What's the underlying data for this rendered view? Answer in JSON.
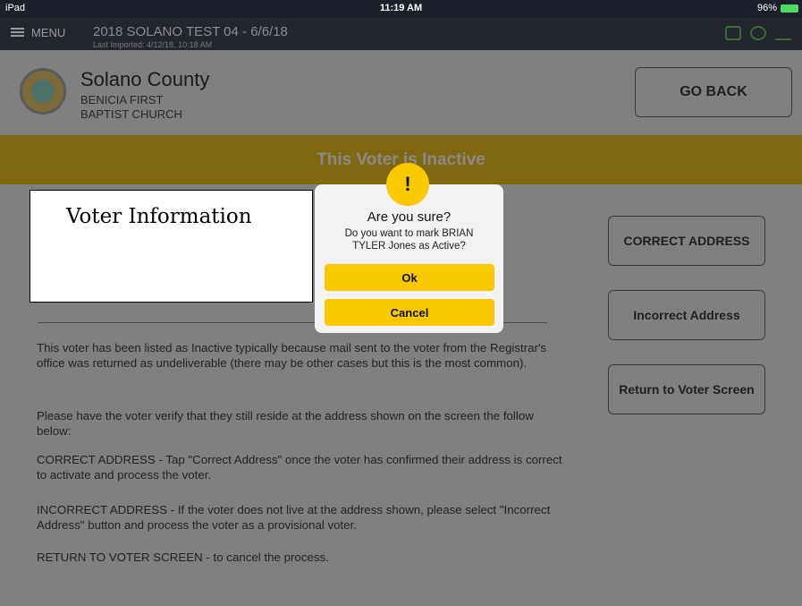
{
  "status_bar": {
    "device": "iPad",
    "time": "11:19 AM",
    "battery": "96%"
  },
  "app_bar": {
    "menu_label": "MENU",
    "title": "2018 SOLANO TEST 04 - 6/6/18",
    "subtitle": "Last Imported: 4/12/18, 10:18 AM",
    "icons": [
      "printer-icon",
      "cloud-icon",
      "users-icon"
    ]
  },
  "header": {
    "county": "Solano County",
    "location_line1": "BENICIA FIRST",
    "location_line2": "BAPTIST CHURCH",
    "go_back_label": "GO BACK"
  },
  "banner": {
    "text": "This Voter is Inactive"
  },
  "overlay_box": {
    "text": "Voter Information"
  },
  "dialog": {
    "icon": "!",
    "title": "Are you sure?",
    "message": "Do you want to mark BRIAN TYLER Jones as Active?",
    "ok_label": "Ok",
    "cancel_label": "Cancel"
  },
  "side_buttons": {
    "correct": "CORRECT ADDRESS",
    "incorrect": "Incorrect Address",
    "return": "Return to Voter Screen"
  },
  "body": {
    "p1": "This voter has been listed as Inactive typically because mail sent to the voter from the Registrar's office was returned as undeliverable (there may be other cases but this is the most common).",
    "p2": "Please have the voter verify that they still reside at the address shown on the screen the follow below:",
    "p3": "CORRECT ADDRESS -  Tap \"Correct Address\" once the voter has confirmed their address is correct to activate and process the voter.",
    "p4": "INCORRECT ADDRESS - If the voter does not live at the address shown, please select \"Incorrect Address\"  button and process the voter as a provisional voter.",
    "p5": "RETURN TO VOTER SCREEN - to cancel the process."
  },
  "colors": {
    "accent": "#f9c800",
    "banner": "#826713",
    "overlay_dim": "#808080"
  }
}
